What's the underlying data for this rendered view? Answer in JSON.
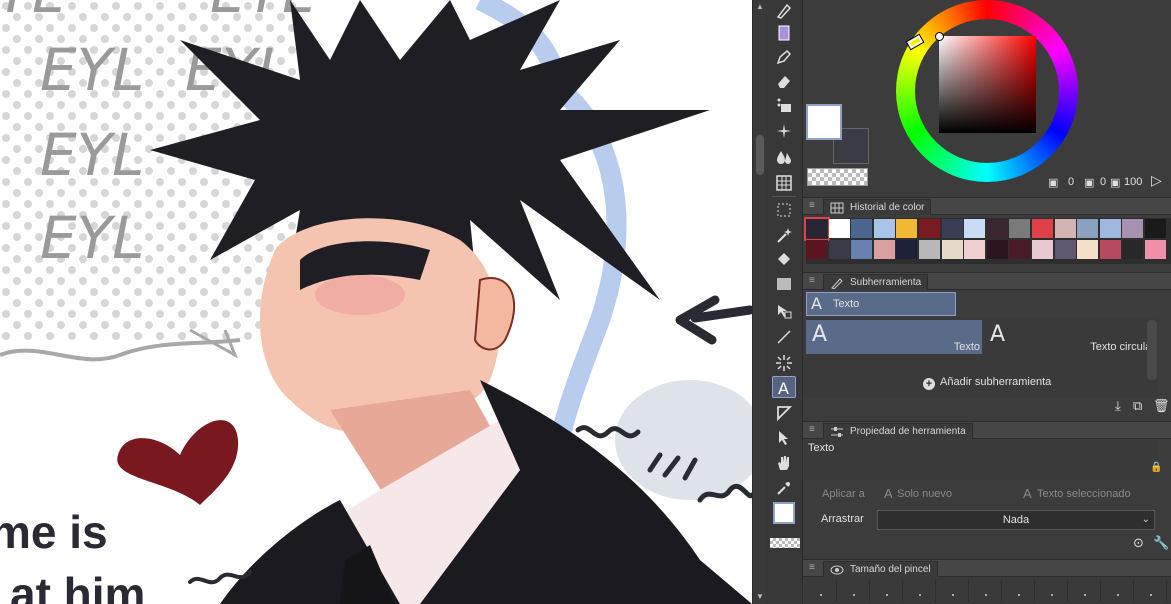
{
  "canvas": {
    "bg_words": [
      "EYL",
      "EYL",
      "EYL",
      "EYL",
      "EYL",
      "EYL"
    ],
    "caption_line1": "me is",
    "caption_line2": "at him"
  },
  "toolbar": {
    "tools": [
      "pen-tool-icon",
      "marker-icon",
      "pen-nib-icon",
      "eraser-icon",
      "deco-icon",
      "sparkle-icon",
      "blend-icon",
      "grid-icon",
      "lasso-icon",
      "magic-wand-icon",
      "fill-icon",
      "gradient-icon",
      "move-icon",
      "line-icon",
      "burst-icon",
      "text-icon",
      "frame-icon",
      "select-arrow-icon",
      "hand-icon",
      "eyedropper-icon"
    ],
    "active_tool": "text-icon"
  },
  "color": {
    "main": "#ffffff",
    "sub": "#3b3b44",
    "values": [
      "0",
      "0",
      "100"
    ]
  },
  "history": {
    "title": "Historial de color",
    "swatches_row1": [
      "#2a2535",
      "#ffffff",
      "#4a6690",
      "#a8c4e8",
      "#f2b833",
      "#7a1a22",
      "#3a3e55",
      "#c9dcf5",
      "#3a2530",
      "#7a7a7a",
      "#e04048",
      "#d4b4b0",
      "#8aa2c0",
      "#a0b8e0",
      "#a890b0",
      "#1a1a1a"
    ],
    "swatches_row2": [
      "#5a1520",
      "#3a3a48",
      "#6a80b0",
      "#d8a0a0",
      "#1e2038",
      "#b8b8b8",
      "#e8d8c8",
      "#f0d0d0",
      "#2a1520",
      "#4a1a28",
      "#e8c8d0",
      "#605870",
      "#f4e0c8",
      "#b84a60",
      "#282828",
      "#f090a8"
    ]
  },
  "subtool": {
    "panel_title": "Subherramienta",
    "selected_group": "Texto",
    "items": [
      {
        "label": "Texto",
        "active": true
      },
      {
        "label": "Texto circular",
        "active": false
      }
    ],
    "add_label": "Añadir subherramienta"
  },
  "tool_property": {
    "panel_title": "Propiedad de herramienta",
    "name": "Texto",
    "apply_label": "Aplicar a",
    "option_new": "Solo nuevo",
    "option_selected": "Texto seleccionado",
    "drag_label": "Arrastrar",
    "drag_value": "Nada"
  },
  "brush_size": {
    "panel_title": "Tamaño del pincel"
  }
}
